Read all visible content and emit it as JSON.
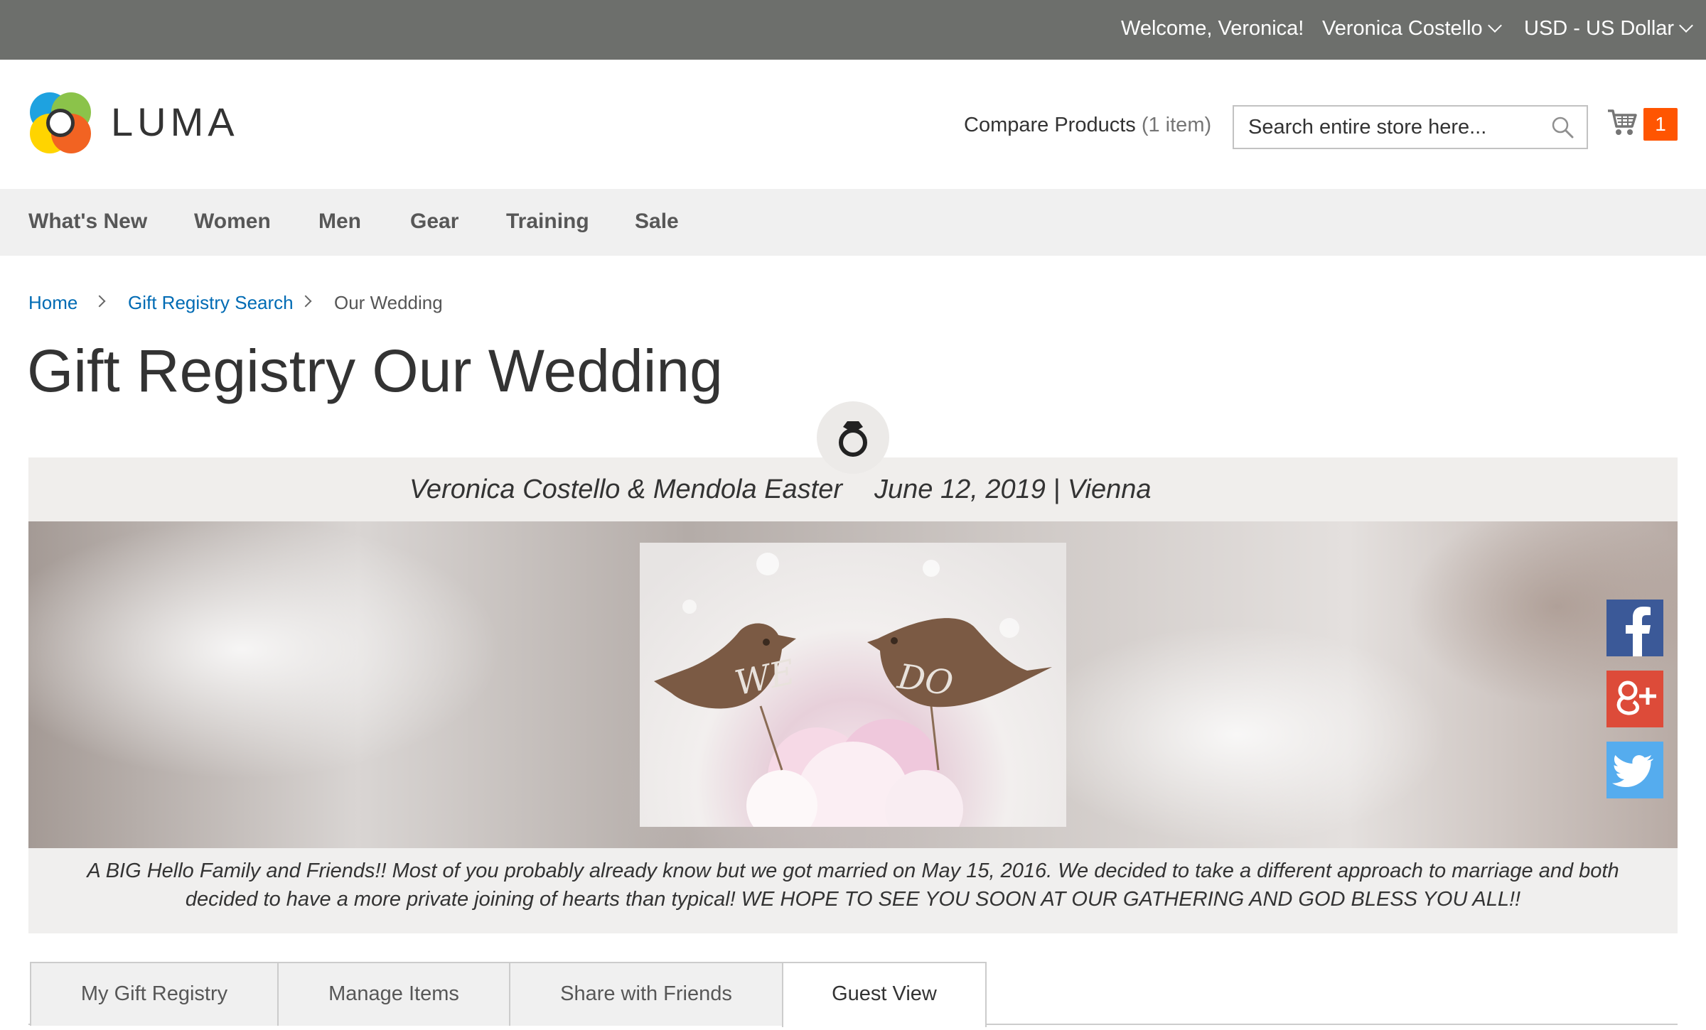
{
  "topbar": {
    "welcome": "Welcome, Veronica!",
    "account": "Veronica Costello",
    "currency": "USD - US Dollar"
  },
  "header": {
    "logo_text": "LUMA",
    "compare_label": "Compare Products",
    "compare_count": "(1 item)",
    "search_placeholder": "Search entire store here...",
    "cart_count": "1"
  },
  "nav": {
    "items": [
      "What's New",
      "Women",
      "Men",
      "Gear",
      "Training",
      "Sale"
    ]
  },
  "breadcrumb": {
    "home": "Home",
    "search": "Gift Registry Search",
    "current": "Our Wedding"
  },
  "page": {
    "title": "Gift Registry Our Wedding"
  },
  "registry": {
    "names": "Veronica Costello & Mendola Easter",
    "date_location": "June 12, 2019 | Vienna",
    "bird_left": "WE",
    "bird_right": "DO",
    "message": "A BIG Hello Family and Friends!! Most of you probably already know but we got married on May 15, 2016. We decided to take a different approach to marriage and both decided to have a more private joining of hearts than typical! WE HOPE TO SEE YOU SOON AT OUR GATHERING AND GOD BLESS YOU ALL!!"
  },
  "social": {
    "facebook_color": "#3b5998",
    "googleplus_color": "#dd4b39",
    "twitter_color": "#55acee"
  },
  "tabs": {
    "my_registry": "My Gift Registry",
    "manage": "Manage Items",
    "share": "Share with Friends",
    "guest": "Guest View"
  },
  "colors": {
    "topbar_bg": "#6d6f6c",
    "link": "#006bb4",
    "cart_badge": "#ff5501"
  }
}
